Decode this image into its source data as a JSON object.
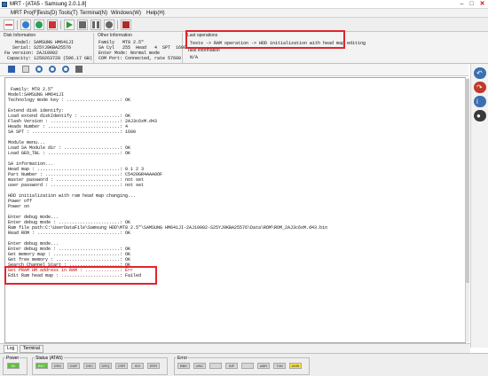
{
  "window": {
    "title": "MRT - [ATA5 - Samsung 2.0.1.8]"
  },
  "menu": [
    "MRT Pro(F)",
    "Tests(D)",
    "Tools(T)",
    "Terminal(N)",
    "Windows(W)",
    "Help(H)"
  ],
  "toolbar": {
    "buttons": [
      {
        "name": "connect-icon",
        "color": "#c0392b"
      },
      {
        "name": "power-icon",
        "color": "#2f7fd0"
      },
      {
        "name": "refresh-icon",
        "color": "#2aa05a"
      },
      {
        "name": "stop-icon",
        "color": "#d03030"
      },
      {
        "name": "play-icon",
        "color": "#2e9a2e"
      },
      {
        "name": "square-icon",
        "color": "#666666"
      },
      {
        "name": "pause-icon",
        "color": "#666666"
      },
      {
        "name": "cancel-icon",
        "color": "#666666"
      },
      {
        "name": "exit-icon",
        "color": "#b02a2a"
      }
    ]
  },
  "disk_info": {
    "title": "Disk Information",
    "lines": [
      "    Model: SAMSUNG HM641JI",
      "   Serial: S25YJ9KBA25576",
      "Fw version: 2AJ10002",
      " Capacity: 1250263728 (596.17 GB)"
    ]
  },
  "other_info": {
    "title": "Other Information",
    "lines": [
      "Family   MT8 2.5\"",
      "SA Cyl   255  Head   4  SPT  1600",
      "Enter Mode: Normal mode",
      "COM Port: Connected, rate 57600"
    ]
  },
  "last_operations": {
    "title": "Last operations",
    "text": "Tests -> RAM operation -> HDD initialization with head map editing"
  },
  "task_info": {
    "title": "Task Information",
    "text": "N/A"
  },
  "log_lines": [
    "",
    " Family: MT8 2.5\"",
    "Model:SAMSUNG HM641JI",
    "Technology mode key : ....................: OK",
    "",
    "Extend disk identify:",
    "Load extend diskIdentify : ...............: OK",
    "Flash Version : ..........................: 2AJ3c6xM.d43",
    "Heads Number : ...........................: 4",
    "SA SPT : .................................: 1600",
    "",
    "Module menu...",
    "Load SA Module dir : .....................: OK",
    "Load GEO_TBL : ...........................: OK",
    "",
    "SA information...",
    "Head map : ...............................: 0 1 2 3",
    "Part Number : ............................: C5420GR4AAA0OF",
    "master password : ........................: not set",
    "user password : ..........................: not set",
    "",
    "HDD initialization with ram head map changing...",
    "Power off",
    "Power on",
    "",
    "Enter debug mode...",
    "Enter debug mode : .......................: OK",
    "Ram file path:C:\\UserDataFile\\Samsung HDD\\MT8 2.5\"\\SAMSUNG HM641JI-2AJ10002-S25YJ9KBA25576\\Data\\ROM\\ROM_2AJ3c6xM.d43.bin",
    "Read ROM : ...............................: OK",
    "",
    "Enter debug mode...",
    "Enter debug mode : .......................: OK",
    "Get memory map : .........................: OK",
    "Get free memory : ........................: OK",
    "Search Channel Start : ...................: OK",
    "Get PRAM HM address in RAM : .............: Err",
    "Edit Ram head map : ......................: Failed"
  ],
  "tabs": [
    "Log",
    "Terminal"
  ],
  "status": {
    "power_label": "Power",
    "power_value": "5V",
    "status_label": "Status (ATA5)",
    "status_flags": [
      {
        "label": "BSY",
        "state": "on"
      },
      {
        "label": "DRD",
        "state": "off"
      },
      {
        "label": "DWF",
        "state": "off"
      },
      {
        "label": "DSC",
        "state": "off"
      },
      {
        "label": "DRQ",
        "state": "off"
      },
      {
        "label": "CRR",
        "state": "off"
      },
      {
        "label": "IDX",
        "state": "off"
      },
      {
        "label": "ERR",
        "state": "off"
      }
    ],
    "error_label": "Error",
    "error_flags": [
      {
        "label": "BBK",
        "state": "off"
      },
      {
        "label": "UNC",
        "state": "off"
      },
      {
        "label": "",
        "state": "off"
      },
      {
        "label": "INF",
        "state": "off"
      },
      {
        "label": "",
        "state": "off"
      },
      {
        "label": "ABR",
        "state": "off"
      },
      {
        "label": "T0N",
        "state": "off"
      },
      {
        "label": "AMN",
        "state": "warn"
      }
    ]
  }
}
